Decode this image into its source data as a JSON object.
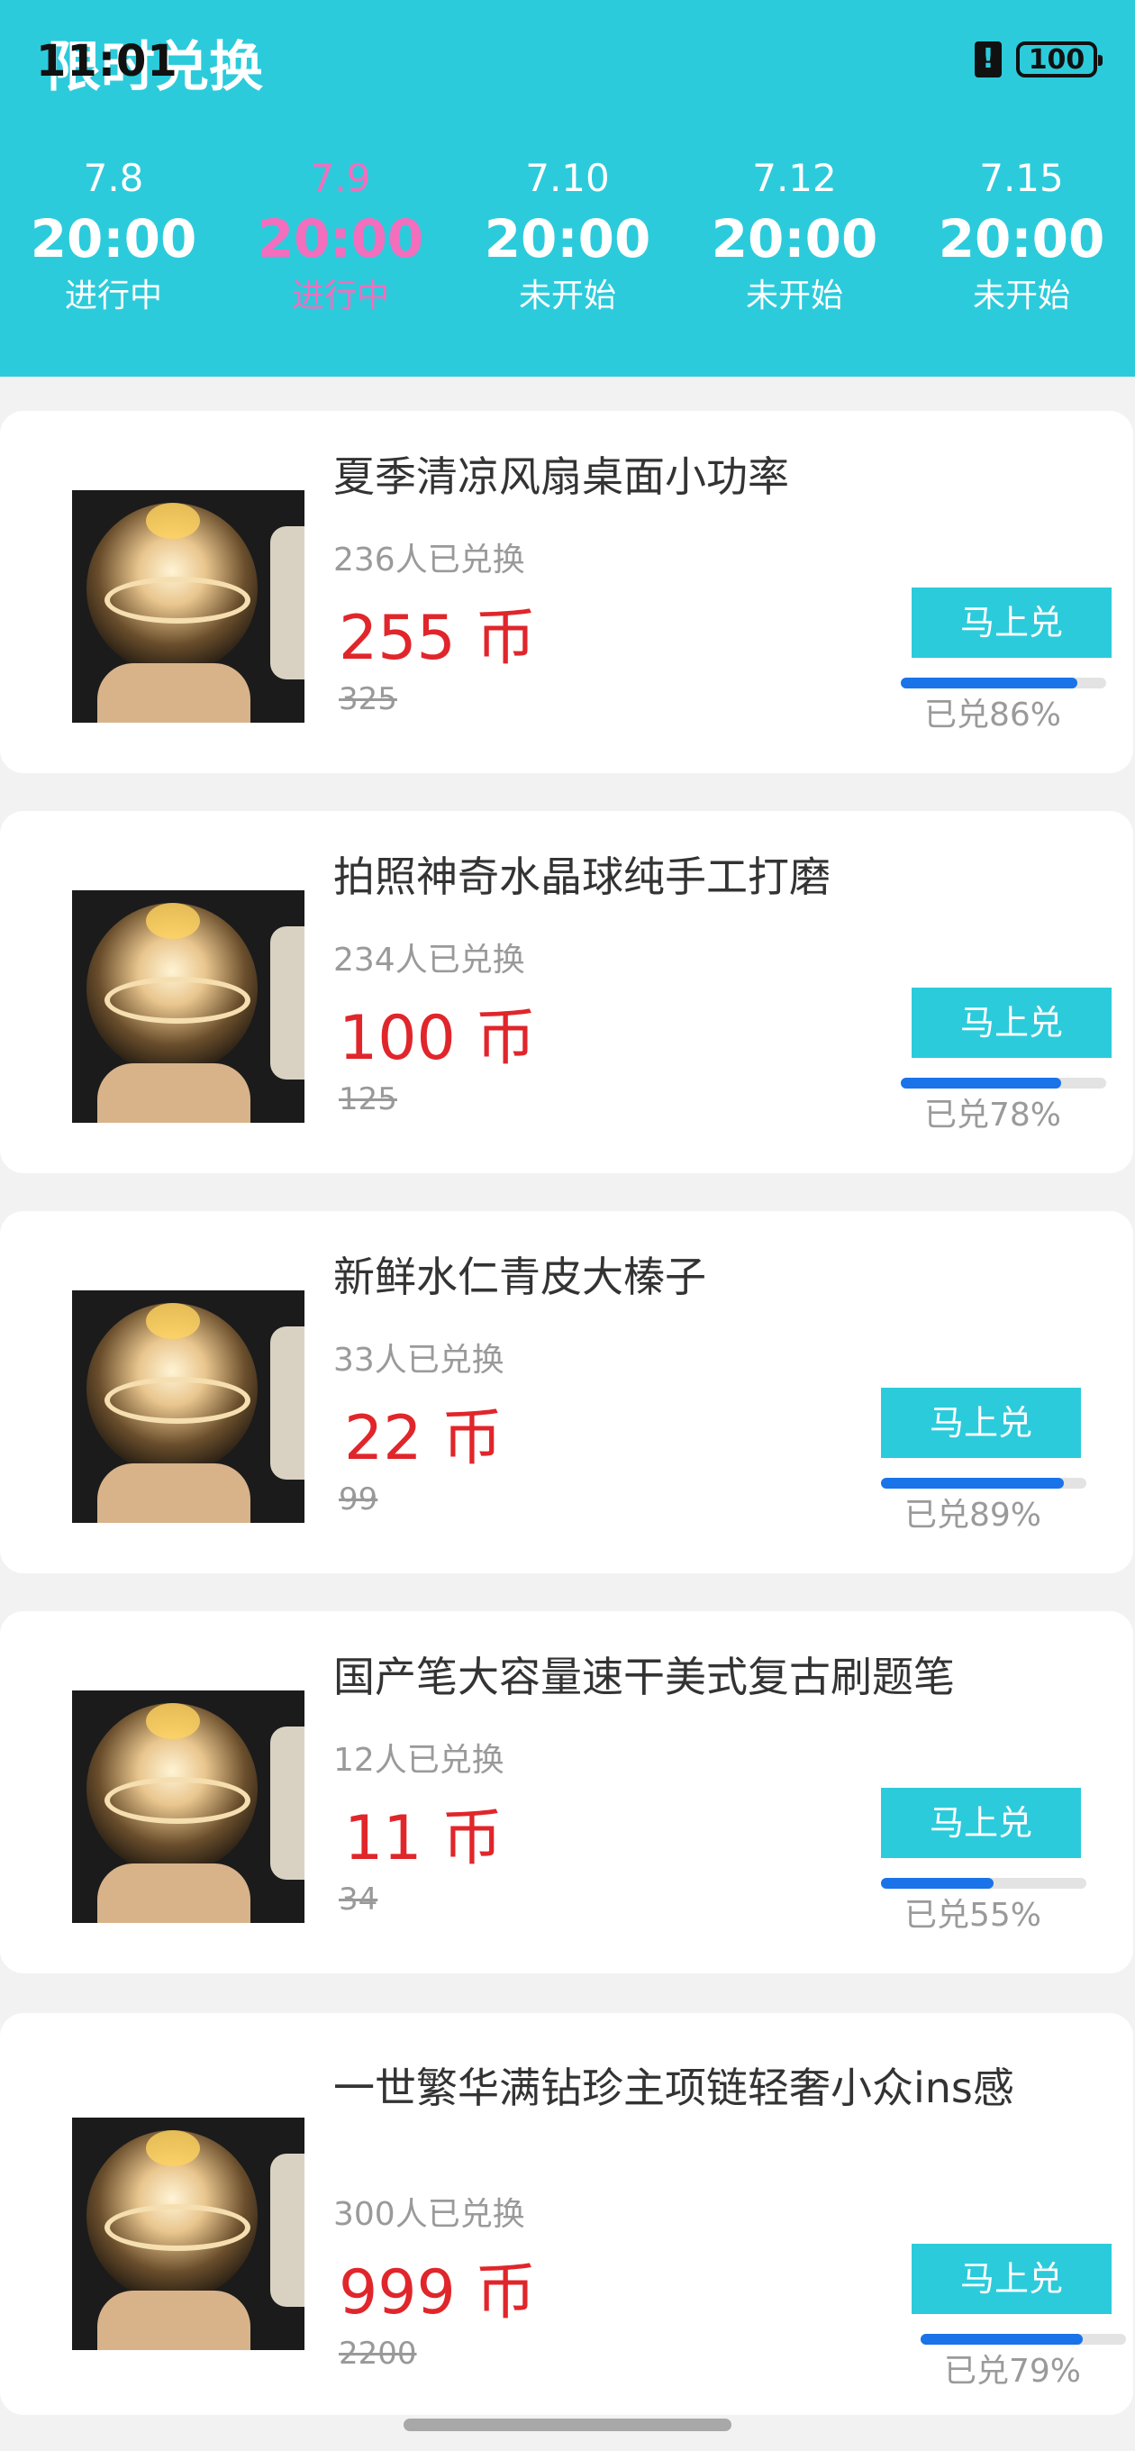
{
  "status_bar": {
    "time": "11:01",
    "battery": "100"
  },
  "page_title": "限时兑换",
  "sessions": [
    {
      "date": "7.8",
      "time": "20:00",
      "state": "进行中",
      "active": false
    },
    {
      "date": "7.9",
      "time": "20:00",
      "state": "进行中",
      "active": true
    },
    {
      "date": "7.10",
      "time": "20:00",
      "state": "未开始",
      "active": false
    },
    {
      "date": "7.12",
      "time": "20:00",
      "state": "未开始",
      "active": false
    },
    {
      "date": "7.15",
      "time": "20:00",
      "state": "未开始",
      "active": false
    }
  ],
  "products": [
    {
      "name": "夏季清凉风扇桌面小功率",
      "count": "236人已兑换",
      "price": "255 币",
      "original": "325",
      "button": "马上兑",
      "progress_label": "已兑86%",
      "progress": 0.86
    },
    {
      "name": "拍照神奇水晶球纯手工打磨",
      "count": "234人已兑换",
      "price": "100 币",
      "original": "125",
      "button": "马上兑",
      "progress_label": "已兑78%",
      "progress": 0.78
    },
    {
      "name": "新鲜水仁青皮大榛子",
      "count": "33人已兑换",
      "price": "22 币",
      "original": "99",
      "button": "马上兑",
      "progress_label": "已兑89%",
      "progress": 0.89
    },
    {
      "name": "国产笔大容量速干美式复古刷题笔",
      "count": "12人已兑换",
      "price": "11 币",
      "original": "34",
      "button": "马上兑",
      "progress_label": "已兑55%",
      "progress": 0.55
    },
    {
      "name": "一世繁华满钻珍主项链轻奢小众ins感",
      "count": "300人已兑换",
      "price": "999 币",
      "original": "2200",
      "button": "马上兑",
      "progress_label": "已兑79%",
      "progress": 0.79
    }
  ],
  "colors": {
    "header_bg": "#2ccbdb",
    "active_session": "#f36ebd",
    "price": "#e0262b",
    "progress_fill": "#1a73e8"
  }
}
